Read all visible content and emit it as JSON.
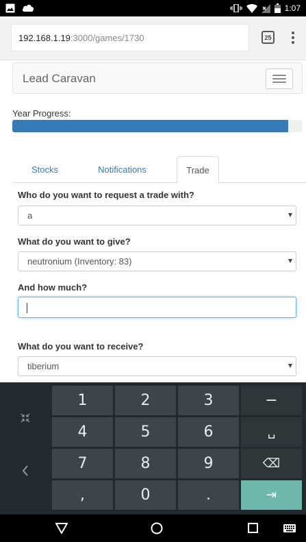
{
  "status_bar": {
    "time": "1:07",
    "icons": [
      "image-icon",
      "cloud-icon",
      "vibrate-icon",
      "wifi-icon",
      "signal-icon",
      "battery-icon"
    ]
  },
  "browser": {
    "url_host": "192.168.1.19",
    "url_path": ":3000/games/1730",
    "tab_count": "25",
    "icons": [
      "tabs-icon",
      "overflow-menu-icon"
    ]
  },
  "navbar": {
    "brand": "Lead Caravan",
    "icon": "hamburger-menu-icon"
  },
  "progress": {
    "label": "Year Progress:",
    "value_percent": 95,
    "color": "#337ab7"
  },
  "tabs": [
    {
      "label": "Stocks",
      "active": false
    },
    {
      "label": "Notifications",
      "active": false
    },
    {
      "label": "Trade",
      "active": true
    }
  ],
  "form": {
    "partner_label": "Who do you want to request a trade with?",
    "partner_value": "a",
    "give_label": "What do you want to give?",
    "give_value": "neutronium (Inventory: 83)",
    "amount_label": "And how much?",
    "amount_value": "",
    "receive_label": "What do you want to receive?",
    "receive_value": "tiberium"
  },
  "keyboard": {
    "keys": [
      [
        "1",
        "2",
        "3",
        "−"
      ],
      [
        "4",
        "5",
        "6",
        "␣"
      ],
      [
        "7",
        "8",
        "9",
        "⌫"
      ],
      [
        ",",
        "0",
        ".",
        "⇥"
      ]
    ],
    "accent_color": "#6eb7ad",
    "side_icons": [
      "collapse-keyboard-icon",
      "back-arrow-icon"
    ]
  },
  "system_nav": {
    "icons": [
      "back-icon",
      "home-icon",
      "recents-icon",
      "keyboard-switch-icon"
    ]
  }
}
